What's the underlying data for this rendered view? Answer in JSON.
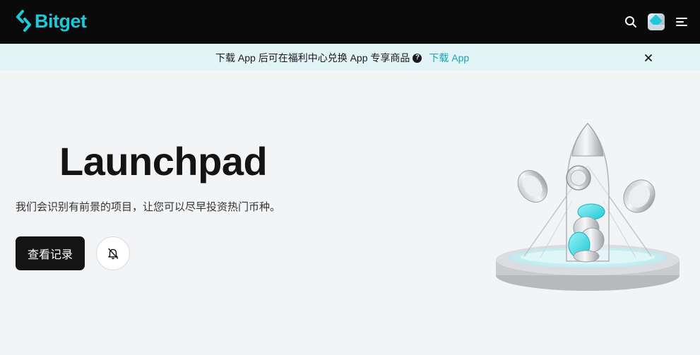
{
  "header": {
    "brand": "Bitget",
    "brand_color": "#1ec8d8",
    "icons": [
      "search-icon",
      "avatar",
      "menu-icon"
    ]
  },
  "banner": {
    "text": "下载 App 后可在福利中心兑换 App 专享商品",
    "help_glyph": "?",
    "link_label": "下载 App",
    "close_icon": "close-icon"
  },
  "hero": {
    "title": "Launchpad",
    "subtitle": "我们会识别有前景的项目，让您可以尽早投资热门币种。",
    "history_button": "查看记录",
    "bell_icon": "bell-off-icon"
  },
  "colors": {
    "topbar_bg": "#0a0a0a",
    "banner_bg": "#e3f4f6",
    "link": "#12a6b8",
    "page_bg": "#f3f4f6"
  }
}
